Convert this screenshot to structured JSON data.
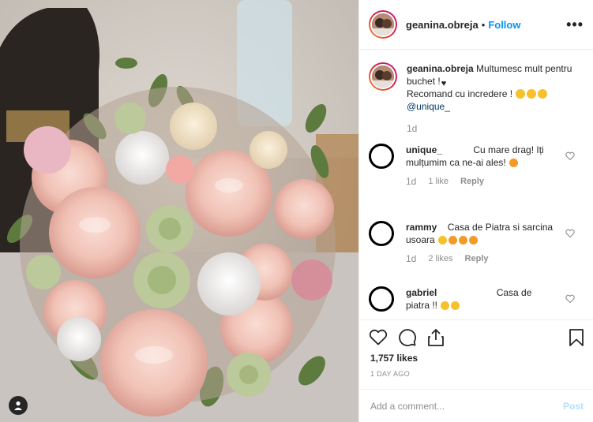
{
  "header": {
    "username": "geanina.obreja",
    "separator": "•",
    "follow_label": "Follow",
    "more_label": "•••"
  },
  "caption": {
    "username": "geanina.obreja",
    "line1": "Multumesc mult pentru buchet !",
    "line2": "Recomand cu incredere !",
    "mention": "@unique_",
    "time": "1d"
  },
  "comments": [
    {
      "username": "unique_",
      "text": "Cu mare drag! Iți mulțumim ca ne-ai ales!",
      "time": "1d",
      "likes": "1 like",
      "reply": "Reply"
    },
    {
      "username": "rammy",
      "text": "Casa de Piatra si sarcina usoara",
      "time": "1d",
      "likes": "2 likes",
      "reply": "Reply"
    },
    {
      "username": "gabriel",
      "text": "Casa de piatra !!",
      "time": "",
      "likes": "",
      "reply": ""
    }
  ],
  "actions": {
    "likes": "1,757 likes",
    "date": "1 DAY AGO"
  },
  "add_comment": {
    "placeholder": "Add a comment...",
    "post_label": "Post"
  },
  "icons": [
    "heart-icon",
    "comment-icon",
    "share-icon",
    "bookmark-icon",
    "more-icon",
    "user-tag-icon"
  ],
  "colors": {
    "link": "#00376b",
    "follow": "#0095f6",
    "muted": "#8e8e8e",
    "post_disabled": "#b2dffc"
  }
}
